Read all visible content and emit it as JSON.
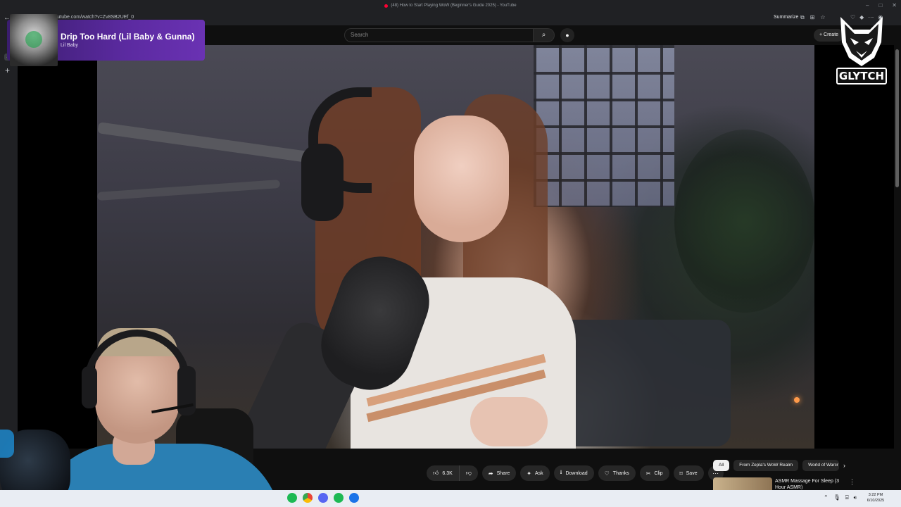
{
  "browser": {
    "tab_title": "(48) How to Start Playing WoW (Beginner's Guide 2025) - YouTube",
    "url": "youtube.com/watch?v=Zv8SB2UEf_0",
    "summarize_label": "Summarize",
    "window_controls": [
      "–",
      "□",
      "✕"
    ]
  },
  "youtube": {
    "search_placeholder": "Search",
    "create_label": "+ Create"
  },
  "now_playing": {
    "title": "Drip Too Hard (Lil Baby & Gunna)",
    "artist": "Lil Baby"
  },
  "video_actions": {
    "like_count": "6.3K",
    "share": "Share",
    "ask": "Ask",
    "download": "Download",
    "thanks": "Thanks",
    "clip": "Clip",
    "save": "Save",
    "more": "⋯"
  },
  "chips": [
    {
      "label": "All",
      "active": true
    },
    {
      "label": "From Zepla's WoW Realm",
      "active": false
    },
    {
      "label": "World of Warcr",
      "active": false
    }
  ],
  "suggested": {
    "title": "ASMR Massage For Sleep (3 Hour ASMR)"
  },
  "overlay": {
    "logo_text": "GLYTCH"
  },
  "taskbar": {
    "time": "3:22 PM",
    "date": "6/10/2025"
  },
  "colors": {
    "youtube_bg": "#0f0f0f",
    "chip_active": "#f1f1f1",
    "spotify_card": "#5b2aa0",
    "taskbar": "#e9edf3"
  }
}
